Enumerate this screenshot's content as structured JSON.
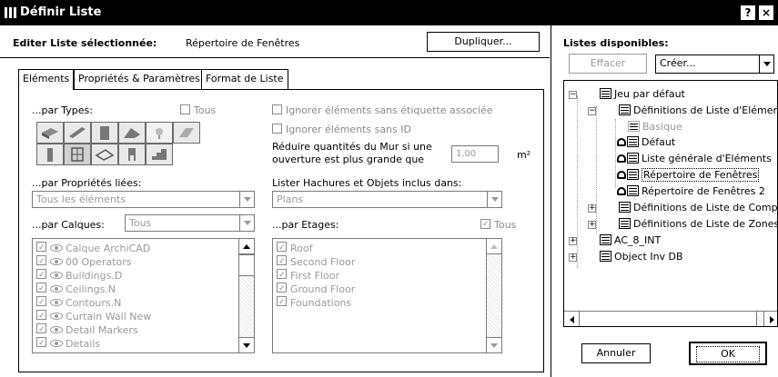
{
  "window": {
    "title": "Définir Liste",
    "help_label": "?",
    "close_label": "×"
  },
  "header": {
    "label": "Editer Liste sélectionnée:",
    "selected": "Répertoire de Fenêtres",
    "duplicate_button": "Dupliquer..."
  },
  "tabs": [
    {
      "label": "Eléments"
    },
    {
      "label": "Propriétés & Paramètres"
    },
    {
      "label": "Format de Liste"
    }
  ],
  "types": {
    "label": "...par Types:",
    "all_label": "Tous"
  },
  "options": {
    "ignore_no_label": "Ignorer éléments sans étiquette associée",
    "ignore_no_id": "Ignorer éléments sans ID",
    "reduce_wall_line1": "Réduire quantités du Mur si une",
    "reduce_wall_line2": "ouverture est plus grande que",
    "reduce_value": "1,00",
    "unit": "m²"
  },
  "linked_props": {
    "label": "...par Propriétés liées:",
    "value": "Tous les éléments"
  },
  "hatches": {
    "label": "Lister Hachures et Objets inclus dans:",
    "value": "Plans"
  },
  "layers": {
    "label": "...par Calques:",
    "value": "Tous",
    "items": [
      "Calque ArchiCAD",
      "00 Operators",
      "Buildings.D",
      "Ceilings.N",
      "Contours.N",
      "Curtain Wall New",
      "Detail Markers",
      "Details"
    ]
  },
  "stories": {
    "label": "...par Etages:",
    "all_label": "Tous",
    "items": [
      "Roof",
      "Second Floor",
      "First Floor",
      "Ground Floor",
      "Foundations"
    ]
  },
  "available": {
    "label": "Listes disponibles:",
    "delete_button": "Effacer",
    "create_value": "Créer...",
    "tree": [
      {
        "label": "Jeu par défaut"
      },
      {
        "label": "Définitions de Liste d'Eléments"
      },
      {
        "label": "Basique"
      },
      {
        "label": "Défaut"
      },
      {
        "label": "Liste générale d'Eléments"
      },
      {
        "label": "Répertoire de Fenêtres"
      },
      {
        "label": "Répertoire de Fenêtres 2"
      },
      {
        "label": "Définitions de Liste de Composants"
      },
      {
        "label": "Définitions de Liste de Zones"
      },
      {
        "label": "AC_8_INT"
      },
      {
        "label": "Object Inv DB"
      }
    ]
  },
  "footer": {
    "cancel_button": "Annuler",
    "ok_button": "OK"
  }
}
